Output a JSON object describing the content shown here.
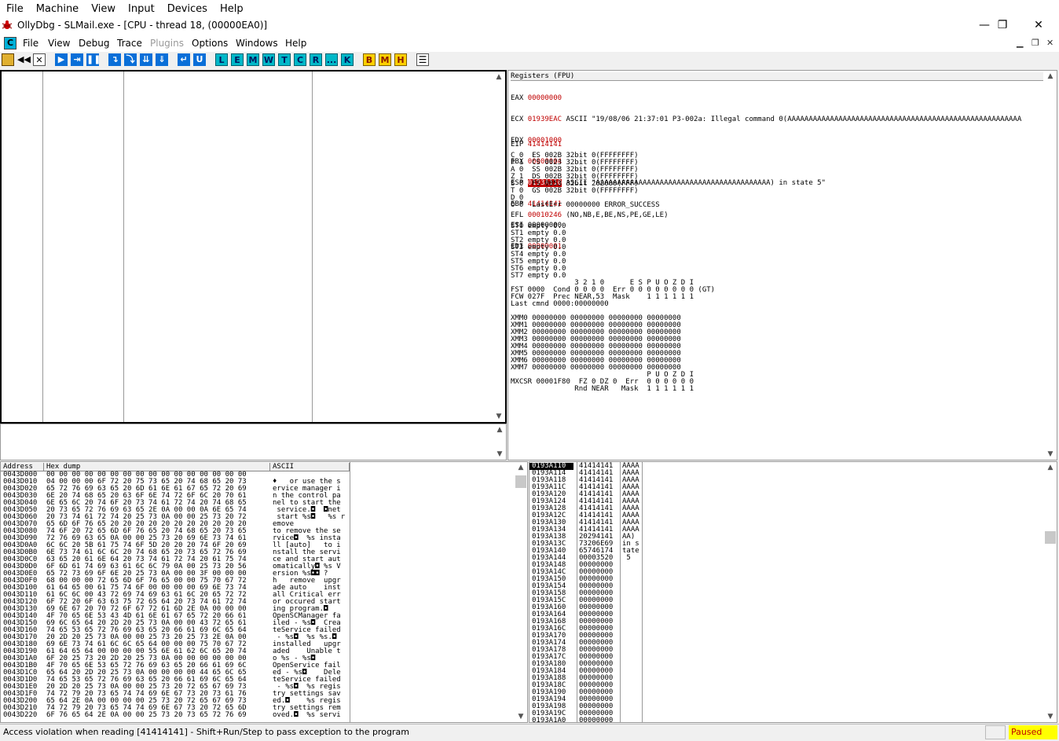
{
  "host_menu": [
    "File",
    "Machine",
    "View",
    "Input",
    "Devices",
    "Help"
  ],
  "window": {
    "title": "OllyDbg - SLMail.exe - [CPU - thread 18, (00000EA0)]",
    "minimize": "—",
    "restore": "❐",
    "close": "✕"
  },
  "app_menu": {
    "icon": "C",
    "items": [
      "File",
      "View",
      "Debug",
      "Trace",
      "Plugins",
      "Options",
      "Windows",
      "Help"
    ]
  },
  "toolbar": {
    "letters": [
      "L",
      "E",
      "M",
      "W",
      "T",
      "C",
      "R",
      "...",
      "K"
    ],
    "yellow": [
      "B",
      "M",
      "H"
    ]
  },
  "registers": {
    "header": "Registers (FPU)",
    "eax": {
      "name": "EAX",
      "value": "00000000"
    },
    "ecx": {
      "name": "ECX",
      "value": "01939EAC",
      "comment": "ASCII \"19/08/06 21:37:01 P3-002a: Illegal command 0(AAAAAAAAAAAAAAAAAAAAAAAAAAAAAAAAAAAAAAAAAAAAAAAAAAAAAAA"
    },
    "edx": {
      "name": "EDX",
      "value": "00001000"
    },
    "ebx": {
      "name": "EBX",
      "value": "00000004"
    },
    "esp": {
      "name": "ESP",
      "value": "0193A110",
      "comment": "ASCII \"AAAAAAAAAAAAAAAAAAAAAAAAAAAAAAAAAAAAAAAAA) in state 5\""
    },
    "ebp": {
      "name": "EBP",
      "value": "41414141"
    },
    "esi": {
      "name": "ESI",
      "value": "00000000"
    },
    "edi": {
      "name": "EDI",
      "value": "00000001"
    },
    "eip": {
      "name": "EIP",
      "value": "41414141"
    },
    "flags_block": "C 0  ES 002B 32bit 0(FFFFFFFF)\nP 1  CS 0023 32bit 0(FFFFFFFF)\nA 0  SS 002B 32bit 0(FFFFFFFF)\nZ 1  DS 002B 32bit 0(FFFFFFFF)\nS 0  FS 0053 32bit 202000(FFF)\nT 0  GS 002B 32bit 0(FFFFFFFF)\nD 0\nO 0  LastErr 00000000 ERROR_SUCCESS",
    "efl": {
      "name": "EFL",
      "value": "00010246",
      "comment": "(NO,NB,E,BE,NS,PE,GE,LE)"
    },
    "fpu_block": "ST0 empty 0.0\nST1 empty 0.0\nST2 empty 0.0\nST3 empty 0.0\nST4 empty 0.0\nST5 empty 0.0\nST6 empty 0.0\nST7 empty 0.0\n               3 2 1 0      E S P U O Z D I\nFST 0000  Cond 0 0 0 0  Err 0 0 0 0 0 0 0 0 (GT)\nFCW 027F  Prec NEAR,53  Mask    1 1 1 1 1 1\nLast cmnd 0000:00000000",
    "xmm_block": "XMM0 00000000 00000000 00000000 00000000\nXMM1 00000000 00000000 00000000 00000000\nXMM2 00000000 00000000 00000000 00000000\nXMM3 00000000 00000000 00000000 00000000\nXMM4 00000000 00000000 00000000 00000000\nXMM5 00000000 00000000 00000000 00000000\nXMM6 00000000 00000000 00000000 00000000\nXMM7 00000000 00000000 00000000 00000000\n                                P U O Z D I\nMXCSR 00001F80  FZ 0 DZ 0  Err  0 0 0 0 0 0\n               Rnd NEAR   Mask  1 1 1 1 1 1"
  },
  "dump": {
    "headers": {
      "address": "Address",
      "hex": "Hex dump",
      "ascii": "ASCII"
    },
    "address_lines": "0043D000\n0043D010\n0043D020\n0043D030\n0043D040\n0043D050\n0043D060\n0043D070\n0043D080\n0043D090\n0043D0A0\n0043D0B0\n0043D0C0\n0043D0D0\n0043D0E0\n0043D0F0\n0043D100\n0043D110\n0043D120\n0043D130\n0043D140\n0043D150\n0043D160\n0043D170\n0043D180\n0043D190\n0043D1A0\n0043D1B0\n0043D1C0\n0043D1D0\n0043D1E0\n0043D1F0\n0043D200\n0043D210\n0043D220",
    "hex_lines": "00 00 00 00 00 00 00 00 00 00 00 00 00 00 00 00\n04 00 00 00 6F 72 20 75 73 65 20 74 68 65 20 73\n65 72 76 69 63 65 20 6D 61 6E 61 67 65 72 20 69\n6E 20 74 68 65 20 63 6F 6E 74 72 6F 6C 20 70 61\n6E 65 6C 20 74 6F 20 73 74 61 72 74 20 74 68 65\n20 73 65 72 76 69 63 65 2E 0A 00 00 0A 6E 65 74\n20 73 74 61 72 74 20 25 73 0A 00 00 25 73 20 72\n65 6D 6F 76 65 20 20 20 20 20 20 20 20 20 20 20\n74 6F 20 72 65 6D 6F 76 65 20 74 68 65 20 73 65\n72 76 69 63 65 0A 00 00 25 73 20 69 6E 73 74 61\n6C 6C 20 5B 61 75 74 6F 5D 20 20 20 74 6F 20 69\n6E 73 74 61 6C 6C 20 74 68 65 20 73 65 72 76 69\n63 65 20 61 6E 64 20 73 74 61 72 74 20 61 75 74\n6F 6D 61 74 69 63 61 6C 6C 79 0A 00 25 73 20 56\n65 72 73 69 6F 6E 20 25 73 0A 00 00 3F 00 00 00\n68 00 00 00 72 65 6D 6F 76 65 00 00 75 70 67 72\n61 64 65 00 61 75 74 6F 00 00 00 00 69 6E 73 74\n61 6C 6C 00 43 72 69 74 69 63 61 6C 20 65 72 72\n6F 72 20 6F 63 63 75 72 65 64 20 73 74 61 72 74\n69 6E 67 20 70 72 6F 67 72 61 6D 2E 0A 00 00 00\n4F 70 65 6E 53 43 4D 61 6E 61 67 65 72 20 66 61\n69 6C 65 64 20 2D 20 25 73 0A 00 00 43 72 65 61\n74 65 53 65 72 76 69 63 65 20 66 61 69 6C 65 64\n20 2D 20 25 73 0A 00 00 25 73 20 25 73 2E 0A 00\n69 6E 73 74 61 6C 6C 65 64 00 00 00 75 70 67 72\n61 64 65 64 00 00 00 00 55 6E 61 62 6C 65 20 74\n6F 20 25 73 20 2D 20 25 73 0A 00 00 00 00 00 00\n4F 70 65 6E 53 65 72 76 69 63 65 20 66 61 69 6C\n65 64 20 2D 20 25 73 0A 00 00 00 00 44 65 6C 65\n74 65 53 65 72 76 69 63 65 20 66 61 69 6C 65 64\n20 2D 20 25 73 0A 00 00 25 73 20 72 65 67 69 73\n74 72 79 20 73 65 74 74 69 6E 67 73 20 73 61 76\n65 64 2E 0A 00 00 00 00 25 73 20 72 65 67 69 73\n74 72 79 20 73 65 74 74 69 6E 67 73 20 72 65 6D\n6F 76 65 64 2E 0A 00 00 25 73 20 73 65 72 76 69",
    "ascii_lines": "\n♦   or use the s\nervice manager i\nn the control pa\nnel to start the\n service.◘  ◘net\n start %s◘   %s r\nemove           \nto remove the se\nrvice◘  %s insta\nll [auto]   to i\nnstall the servi\nce and start aut\nomatically◘ %s V\nersion %s◘◘ ?\nh   remove  upgr\nade auto    inst\nall Critical err\nor occured start\ning program.◘\nOpenSCManager fa\niled - %s◘  Crea\nteService failed\n - %s◘  %s %s.◘\ninstalled   upgr\naded    Unable t\no %s - %s◘\nOpenService fail\ned - %s◘    Dele\nteService failed\n - %s◘  %s regis\ntry settings sav\ned.◘    %s regis\ntry settings rem\noved.◘  %s servi"
  },
  "stack": {
    "top_address": "0193A110",
    "address_lines": "0193A114\n0193A118\n0193A11C\n0193A120\n0193A124\n0193A128\n0193A12C\n0193A130\n0193A134\n0193A138\n0193A13C\n0193A140\n0193A144\n0193A148\n0193A14C\n0193A150\n0193A154\n0193A158\n0193A15C\n0193A160\n0193A164\n0193A168\n0193A16C\n0193A170\n0193A174\n0193A178\n0193A17C\n0193A180\n0193A184\n0193A188\n0193A18C\n0193A190\n0193A194\n0193A198\n0193A19C\n0193A1A0",
    "value_lines": "41414141\n41414141\n41414141\n41414141\n41414141\n41414141\n41414141\n41414141\n41414141\n41414141\n20294141\n73206E69\n65746174\n00003520\n00000000\n00000000\n00000000\n00000000\n00000000\n00000000\n00000000\n00000000\n00000000\n00000000\n00000000\n00000000\n00000000\n00000000\n00000000\n00000000\n00000000\n00000000\n00000000\n00000000\n00000000\n00000000\n00000000",
    "comment_lines": "AAAA\nAAAA\nAAAA\nAAAA\nAAAA\nAAAA\nAAAA\nAAAA\nAAAA\nAAAA\nAA)\nin s\ntate\n 5"
  },
  "status": {
    "message": "Access violation when reading [41414141] - Shift+Run/Step to pass exception to the program",
    "state": "Paused"
  }
}
